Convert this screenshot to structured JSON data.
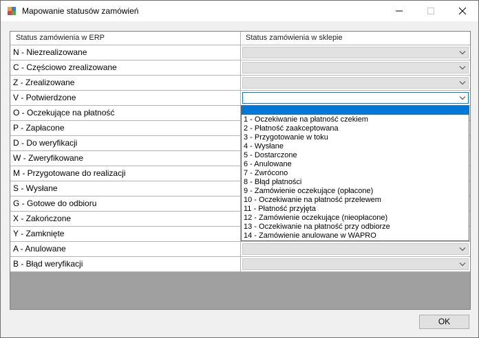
{
  "window": {
    "title": "Mapowanie statusów zamówień"
  },
  "grid": {
    "headers": [
      "Status zamówienia w ERP",
      "Status zamówienia w sklepie"
    ],
    "rows": [
      "N - Niezrealizowane",
      "C - Częściowo zrealizowane",
      "Z - Zrealizowane",
      "V - Potwierdzone",
      "O - Oczekujące na płatność",
      "P - Zapłacone",
      "D - Do weryfikacji",
      "W - Zweryfikowane",
      "M - Przygotowane do realizacji",
      "S - Wysłane",
      "G - Gotowe do odbioru",
      "X - Zakończone",
      "Y - Zamknięte",
      "A - Anulowane",
      "B - Błąd weryfikacji"
    ]
  },
  "dropdown": {
    "options": [
      "1 - Oczekiwanie na płatność czekiem",
      "2 - Płatność zaakceptowana",
      "3 - Przygotowanie w toku",
      "4 - Wysłane",
      "5 - Dostarczone",
      "6 - Anulowane",
      "7 - Zwrócono",
      "8 - Błąd płatności",
      "9 - Zamówienie oczekujące (opłacone)",
      "10 - Oczekiwanie na płatność przelewem",
      "11 - Płatność przyjęta",
      "12 - Zamówienie oczekujące (nieopłacone)",
      "13 - Oczekiwanie na płatność przy odbiorze",
      "14 - Zamówienie anulowane w WAPRO"
    ]
  },
  "buttons": {
    "ok_label": "OK"
  },
  "colors": {
    "accent": "#0078d7",
    "combo_disabled": "#e1e1e1",
    "grid_background": "#a0a0a0"
  }
}
